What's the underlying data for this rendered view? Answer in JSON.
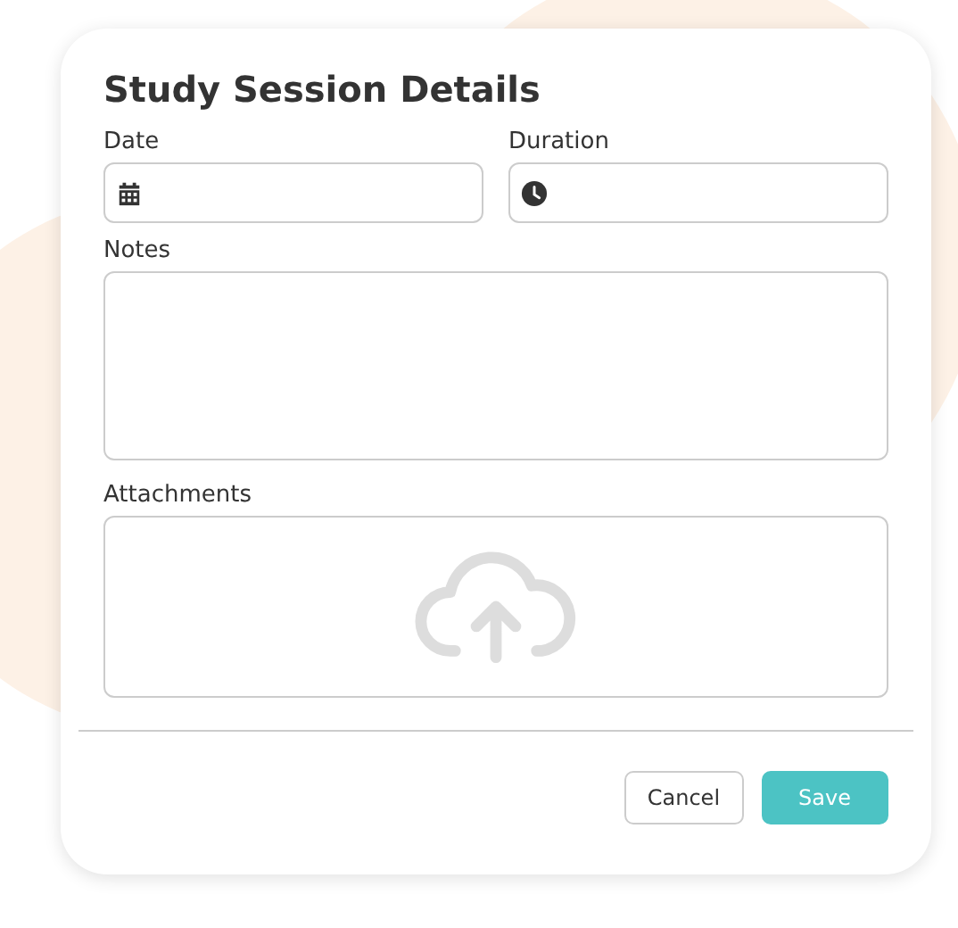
{
  "dialog": {
    "title": "Study Session Details"
  },
  "fields": [
    {
      "label": "Date",
      "kind": "date"
    },
    {
      "label": "Duration",
      "kind": "time"
    }
  ],
  "notes": {
    "label": "Notes"
  },
  "attachments": {
    "label": "Attachments"
  },
  "buttons": [
    {
      "label": "Cancel",
      "kind": "secondary"
    },
    {
      "label": "Save",
      "kind": "primary"
    }
  ]
}
